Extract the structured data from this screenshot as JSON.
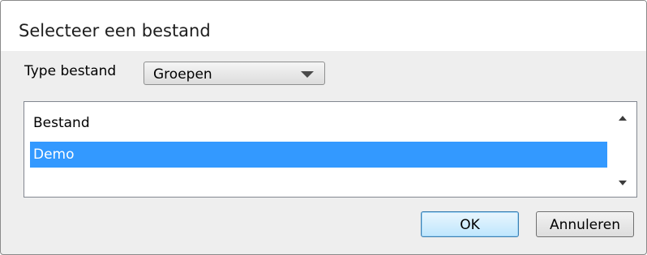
{
  "dialog": {
    "title": "Selecteer een bestand",
    "type_label": "Type bestand",
    "type_select": {
      "selected": "Groepen"
    },
    "file_list": {
      "header": "Bestand",
      "items": [
        {
          "label": "Demo",
          "selected": true
        }
      ]
    },
    "buttons": {
      "ok": "OK",
      "cancel": "Annuleren"
    }
  },
  "colors": {
    "selection": "#3399ff",
    "dialog_background": "#eeeeee"
  },
  "icons": [
    "combo-dropdown-arrow-icon",
    "scroll-up-arrow-icon",
    "scroll-down-arrow-icon"
  ]
}
